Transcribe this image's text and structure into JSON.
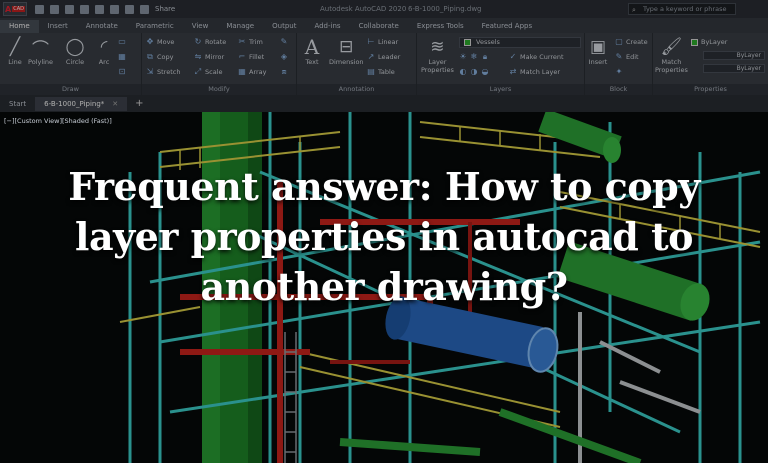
{
  "titlebar": {
    "app_letter": "A",
    "app_sub": "CAD",
    "share_label": "Share",
    "app_title": "Autodesk AutoCAD 2020",
    "doc_title": "6-B-1000_Piping.dwg",
    "search_placeholder": "Type a keyword or phrase"
  },
  "ribbon_tabs": [
    "Home",
    "Insert",
    "Annotate",
    "Parametric",
    "View",
    "Manage",
    "Output",
    "Add-ins",
    "Collaborate",
    "Express Tools",
    "Featured Apps"
  ],
  "draw": {
    "line": "Line",
    "polyline": "Polyline",
    "circle": "Circle",
    "arc": "Arc",
    "panel": "Draw"
  },
  "modify": {
    "move": "Move",
    "rotate": "Rotate",
    "trim": "Trim",
    "copy": "Copy",
    "mirror": "Mirror",
    "fillet": "Fillet",
    "stretch": "Stretch",
    "scale": "Scale",
    "array": "Array",
    "panel": "Modify"
  },
  "annotation": {
    "text": "Text",
    "dimension": "Dimension",
    "linear": "Linear",
    "leader": "Leader",
    "table": "Table",
    "panel": "Annotation"
  },
  "layers": {
    "layer_properties_1": "Layer",
    "layer_properties_2": "Properties",
    "current_layer": "Vessels",
    "make_current": "Make Current",
    "match_layer": "Match Layer",
    "panel": "Layers"
  },
  "block": {
    "insert": "Insert",
    "create": "Create",
    "edit": "Edit",
    "panel": "Block"
  },
  "properties": {
    "match_1": "Match",
    "match_2": "Properties",
    "bylayer_color": "ByLayer",
    "bylayer_2": "ByLayer",
    "bylayer_3": "ByLayer",
    "panel": "Properties"
  },
  "file_tabs": {
    "start": "Start",
    "drawing": "6-B-1000_Piping*"
  },
  "viewport": {
    "label": "[−][Custom View][Shaded (Fast)]"
  },
  "headline": "Frequent answer: How to copy layer properties in autocad to another drawing?"
}
